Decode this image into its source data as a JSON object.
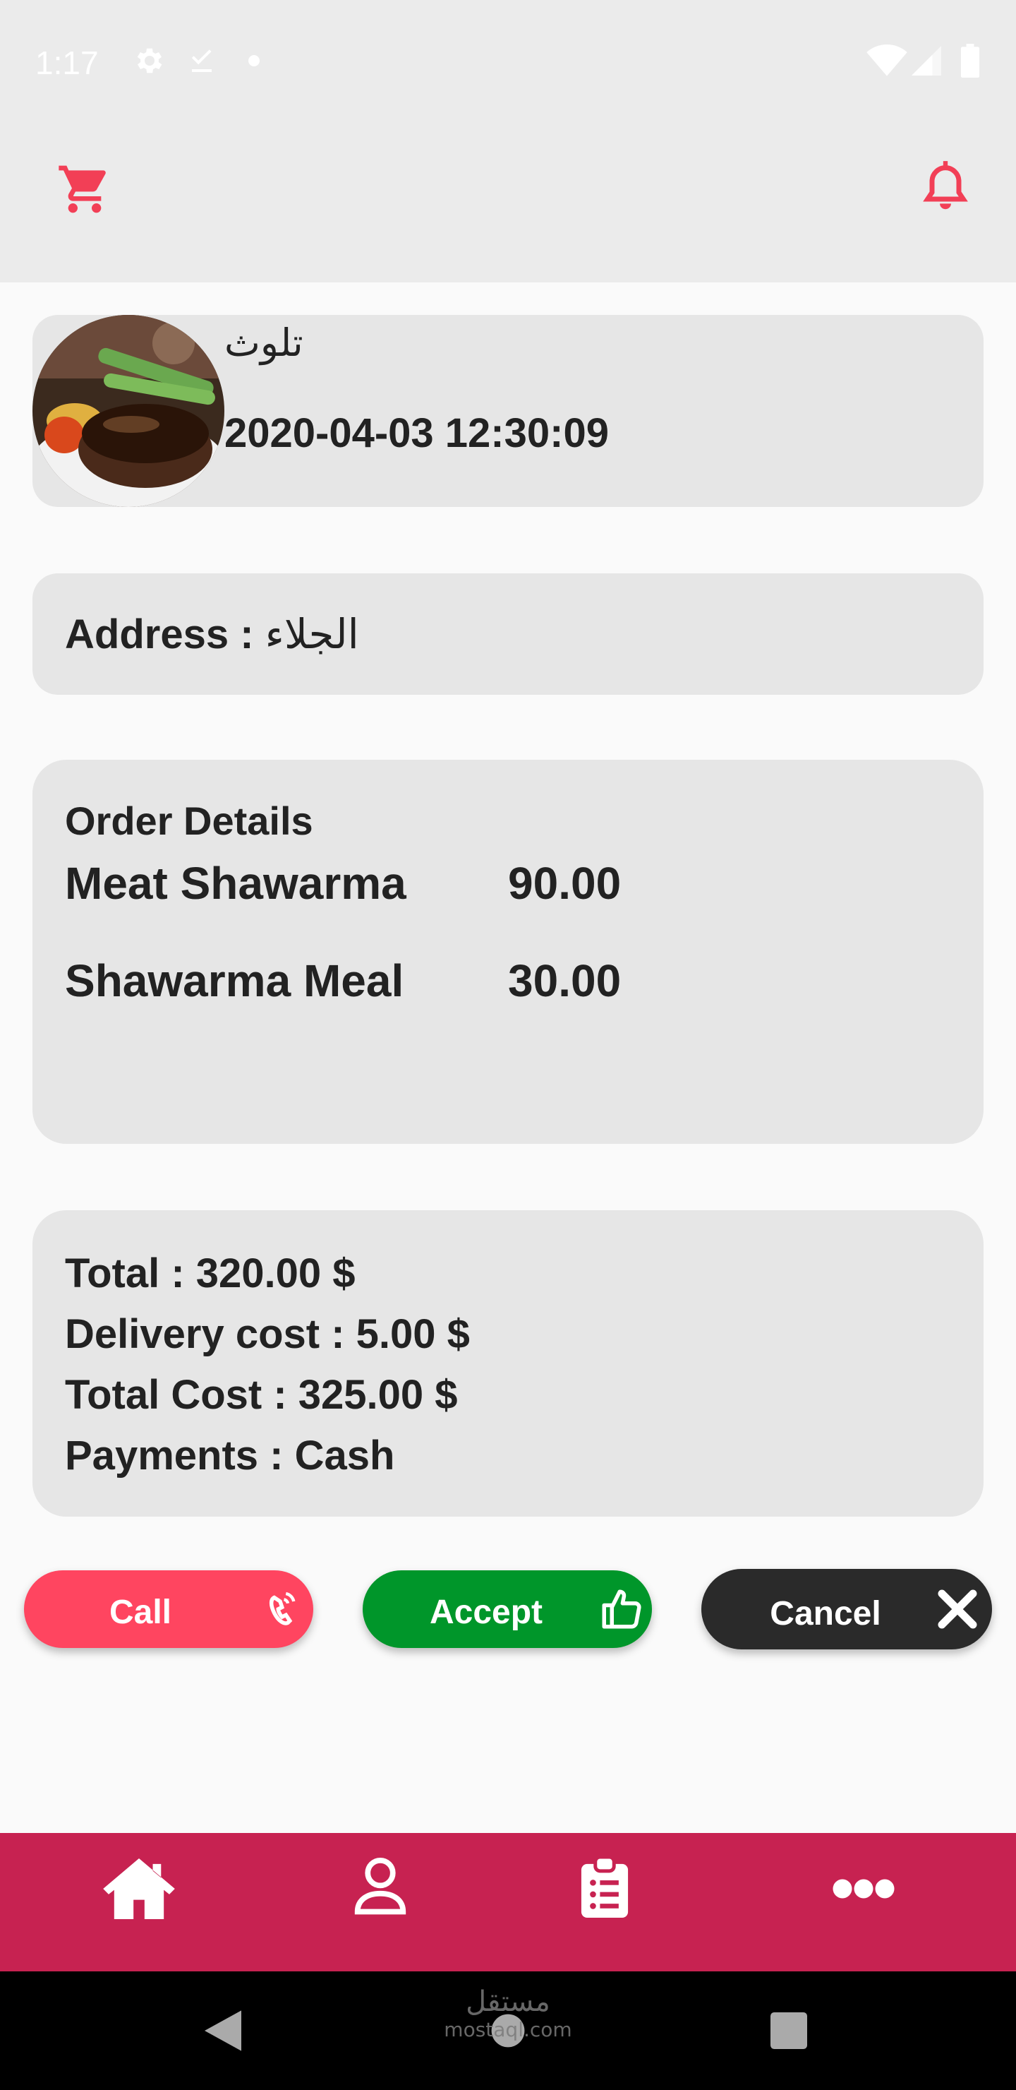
{
  "status_bar": {
    "time": "1:17",
    "icons": [
      "settings-icon",
      "download-done-icon",
      "dot-icon",
      "wifi-icon",
      "signal-icon",
      "battery-icon"
    ]
  },
  "app_bar": {
    "icons": [
      "cart-icon",
      "bell-icon"
    ],
    "accent_color": "#f23f56"
  },
  "order": {
    "customer_name": "تلوث",
    "datetime": "2020-04-03 12:30:09",
    "address_label": "Address : ",
    "address_value": "الجلاء"
  },
  "details": {
    "title": "Order Details",
    "items": [
      {
        "name": "Meat Shawarma",
        "price": "90.00"
      },
      {
        "name": "Shawarma Meal",
        "price": "30.00"
      }
    ]
  },
  "summary": {
    "total": "Total : 320.00 $",
    "delivery": "Delivery cost : 5.00 $",
    "total_cost": "Total Cost : 325.00 $",
    "payment": "Payments : Cash"
  },
  "actions": {
    "call_label": "Call",
    "accept_label": "Accept",
    "cancel_label": "Cancel",
    "colors": {
      "call": "#ff4560",
      "accept": "#00962a",
      "cancel": "#2a2a2a"
    }
  },
  "bottom_nav": {
    "items": [
      "home-icon",
      "profile-icon",
      "orders-icon",
      "more-icon"
    ],
    "color": "#c72251"
  },
  "watermark": {
    "arabic": "مستقل",
    "latin": "mostaql.com"
  }
}
